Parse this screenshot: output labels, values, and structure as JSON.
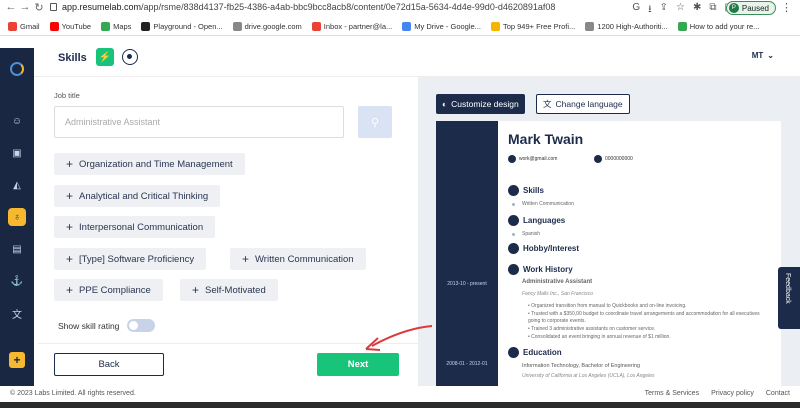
{
  "browser": {
    "url_host": "app.resumelab.com",
    "url_path": "/app/rsme/838d4137-fb25-4386-a4ab-bbc9bcc8acb8/content/0e72d15a-5634-4d4e-99d0-d4620891af08",
    "profile_label": "Paused",
    "profile_initial": "P"
  },
  "bookmarks": [
    {
      "label": "Gmail",
      "color": "#ea4335"
    },
    {
      "label": "YouTube",
      "color": "#ff0000"
    },
    {
      "label": "Maps",
      "color": "#34a853"
    },
    {
      "label": "Playground - Open...",
      "color": "#222222"
    },
    {
      "label": "drive.google.com",
      "color": "#888888"
    },
    {
      "label": "Inbox - partner@la...",
      "color": "#ea4335"
    },
    {
      "label": "My Drive - Google...",
      "color": "#4285f4"
    },
    {
      "label": "Top 949+ Free Profi...",
      "color": "#f4b400"
    },
    {
      "label": "1200 High-Authoriti...",
      "color": "#888888"
    },
    {
      "label": "How to add your re...",
      "color": "#34a853"
    }
  ],
  "header": {
    "section_title": "Skills",
    "user_initials": "MT"
  },
  "form": {
    "job_title_label": "Job title",
    "job_title_placeholder": "Administrative Assistant",
    "skills": [
      "Organization and Time Management",
      "Analytical and Critical Thinking",
      "Interpersonal Communication",
      "[Type] Software Proficiency",
      "Written Communication",
      "PPE Compliance",
      "Self-Motivated"
    ],
    "show_rating_label": "Show skill rating",
    "back_label": "Back",
    "next_label": "Next"
  },
  "preview": {
    "customize_label": "Customize design",
    "language_label": "Change language",
    "name": "Mark Twain",
    "email": "work@gmail.com",
    "phone": "0000000000",
    "sections": {
      "skills": "Skills",
      "skills_item": "Written Communication",
      "languages": "Languages",
      "languages_item": "Spanish",
      "hobby": "Hobby/Interest",
      "work": "Work History",
      "job_title": "Administrative Assistant",
      "company": "Fancy Malls Inc., San Francisco",
      "bullets": [
        "Organized transition from manual to Quickbooks and on-line invoicing.",
        "Trusted with a $350,00 budget to coordinate travel arrangements and accommodation for all executives going to corporate events.",
        "Trained 3 administrative assistants on customer service.",
        "Consolidated an event bringing in annual revenue of $1 million."
      ],
      "work_dates": "2013-10 - present",
      "education": "Education",
      "degree": "Information Technology, Bachelor of Engineering",
      "school": "University of California at Los Angeles (UCLA), Los Angeles",
      "edu_dates": "2008-01 - 2012-01"
    }
  },
  "feedback_label": "Feedback",
  "footer": {
    "copyright": "© 2023 Labs Limited. All rights reserved.",
    "links": [
      "Terms & Services",
      "Privacy policy",
      "Contact"
    ]
  },
  "colors": {
    "navy": "#1d2b4b",
    "green": "#18c47a",
    "accent": "#f5b82e",
    "arrow": "#d93b3b"
  }
}
